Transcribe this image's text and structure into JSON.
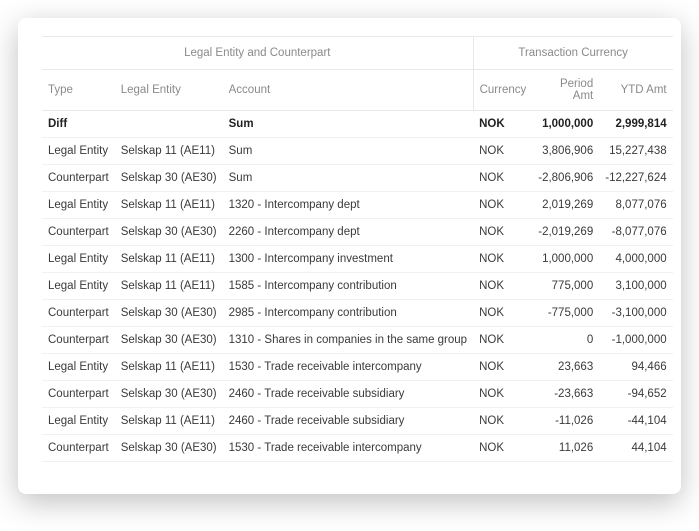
{
  "headers": {
    "group_left": "Legal Entity and Counterpart",
    "group_right": "Transaction Currency",
    "type": "Type",
    "legal_entity": "Legal Entity",
    "account": "Account",
    "currency": "Currency",
    "period_amt": "Period Amt",
    "ytd_amt": "YTD Amt"
  },
  "rows": [
    {
      "bold": true,
      "type": "Diff",
      "legal_entity": "",
      "account": "Sum",
      "currency": "NOK",
      "period_amt": "1,000,000",
      "ytd_amt": "2,999,814"
    },
    {
      "bold": false,
      "type": "Legal Entity",
      "legal_entity": "Selskap 11 (AE11)",
      "account": "Sum",
      "currency": "NOK",
      "period_amt": "3,806,906",
      "ytd_amt": "15,227,438"
    },
    {
      "bold": false,
      "type": "Counterpart",
      "legal_entity": "Selskap 30 (AE30)",
      "account": "Sum",
      "currency": "NOK",
      "period_amt": "-2,806,906",
      "ytd_amt": "-12,227,624"
    },
    {
      "bold": false,
      "type": "Legal Entity",
      "legal_entity": "Selskap 11 (AE11)",
      "account": "1320 - Intercompany dept",
      "currency": "NOK",
      "period_amt": "2,019,269",
      "ytd_amt": "8,077,076"
    },
    {
      "bold": false,
      "type": "Counterpart",
      "legal_entity": "Selskap 30 (AE30)",
      "account": "2260 - Intercompany dept",
      "currency": "NOK",
      "period_amt": "-2,019,269",
      "ytd_amt": "-8,077,076"
    },
    {
      "bold": false,
      "type": "Legal Entity",
      "legal_entity": "Selskap 11 (AE11)",
      "account": "1300 - Intercompany investment",
      "currency": "NOK",
      "period_amt": "1,000,000",
      "ytd_amt": "4,000,000"
    },
    {
      "bold": false,
      "type": "Legal Entity",
      "legal_entity": "Selskap 11 (AE11)",
      "account": "1585 - Intercompany contribution",
      "currency": "NOK",
      "period_amt": "775,000",
      "ytd_amt": "3,100,000"
    },
    {
      "bold": false,
      "type": "Counterpart",
      "legal_entity": "Selskap 30 (AE30)",
      "account": "2985 - Intercompany contribution",
      "currency": "NOK",
      "period_amt": "-775,000",
      "ytd_amt": "-3,100,000"
    },
    {
      "bold": false,
      "type": "Counterpart",
      "legal_entity": "Selskap 30 (AE30)",
      "account": "1310 - Shares in companies in the same group",
      "currency": "NOK",
      "period_amt": "0",
      "ytd_amt": "-1,000,000"
    },
    {
      "bold": false,
      "type": "Legal Entity",
      "legal_entity": "Selskap 11 (AE11)",
      "account": "1530 - Trade receivable intercompany",
      "currency": "NOK",
      "period_amt": "23,663",
      "ytd_amt": "94,466"
    },
    {
      "bold": false,
      "type": "Counterpart",
      "legal_entity": "Selskap 30 (AE30)",
      "account": "2460 - Trade receivable subsidiary",
      "currency": "NOK",
      "period_amt": "-23,663",
      "ytd_amt": "-94,652"
    },
    {
      "bold": false,
      "type": "Legal Entity",
      "legal_entity": "Selskap 11 (AE11)",
      "account": "2460 - Trade receivable subsidiary",
      "currency": "NOK",
      "period_amt": "-11,026",
      "ytd_amt": "-44,104"
    },
    {
      "bold": false,
      "type": "Counterpart",
      "legal_entity": "Selskap 30 (AE30)",
      "account": "1530 - Trade receivable intercompany",
      "currency": "NOK",
      "period_amt": "11,026",
      "ytd_amt": "44,104"
    }
  ]
}
